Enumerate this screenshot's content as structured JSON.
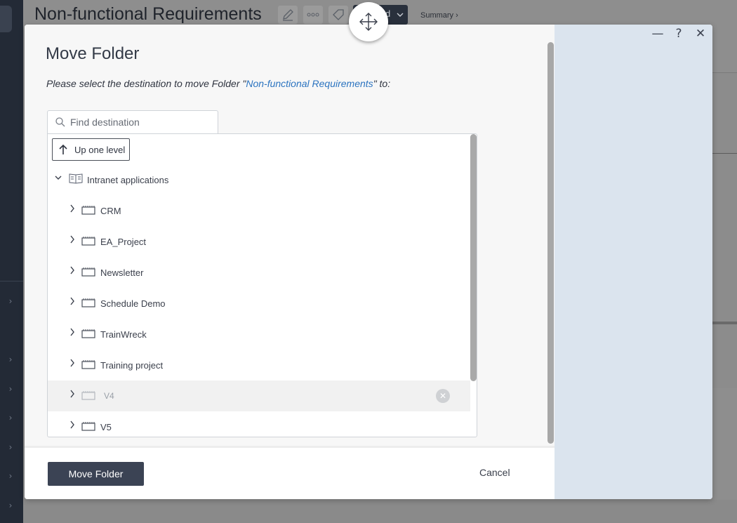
{
  "background": {
    "page_title": "Non-functional Requirements",
    "dark_button_fragment": "d",
    "summary_link": "Summary ›"
  },
  "dialog": {
    "title": "Move Folder",
    "instruction_prefix": "Please select the destination to move Folder \"",
    "instruction_folder": "Non-functional Requirements",
    "instruction_suffix": "\" to:",
    "search": {
      "placeholder": "Find destination",
      "value": ""
    },
    "up_one_level_label": "Up one level",
    "tree": {
      "root": {
        "label": "Intranet applications",
        "expanded": true,
        "icon": "book-icon"
      },
      "children": [
        {
          "label": "CRM",
          "disabled": false,
          "icon": "project-icon"
        },
        {
          "label": "EA_Project",
          "disabled": false,
          "icon": "project-icon"
        },
        {
          "label": "Newsletter",
          "disabled": false,
          "icon": "project-icon"
        },
        {
          "label": "Schedule Demo",
          "disabled": false,
          "icon": "project-icon"
        },
        {
          "label": "TrainWreck",
          "disabled": false,
          "icon": "project-icon"
        },
        {
          "label": "Training project",
          "disabled": false,
          "icon": "project-icon"
        },
        {
          "label": "V4",
          "disabled": true,
          "icon": "project-icon"
        },
        {
          "label": "V5",
          "disabled": false,
          "icon": "project-icon"
        }
      ]
    },
    "primary_button": "Move Folder",
    "cancel_button": "Cancel",
    "window_controls": {
      "minimize": "—",
      "help": "?",
      "close": "✕"
    }
  },
  "colors": {
    "primary": "#3b4354",
    "link": "#2c74c0",
    "side_panel": "#dbe4ee"
  }
}
